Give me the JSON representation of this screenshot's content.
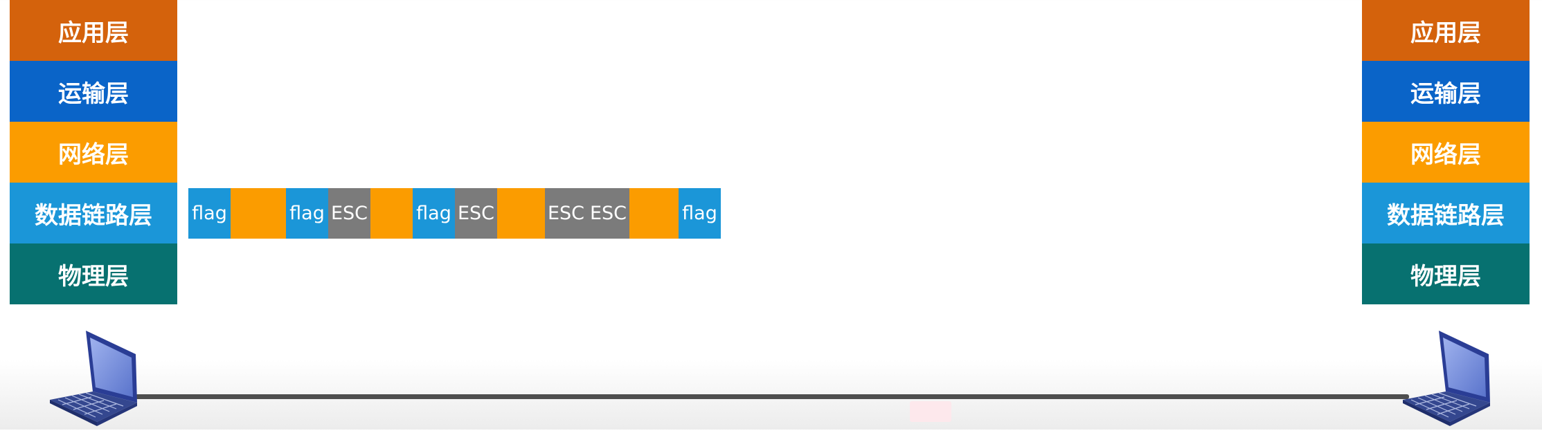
{
  "left_stack": {
    "layers": [
      "应用层",
      "运输层",
      "网络层",
      "数据链路层",
      "物理层"
    ]
  },
  "right_stack": {
    "layers": [
      "应用层",
      "运输层",
      "网络层",
      "数据链路层",
      "物理层"
    ]
  },
  "frame": {
    "segments": [
      {
        "type": "flag",
        "label": "flag"
      },
      {
        "type": "data",
        "label": ""
      },
      {
        "type": "flag",
        "label": "flag"
      },
      {
        "type": "esc",
        "label": "ESC"
      },
      {
        "type": "data",
        "label": ""
      },
      {
        "type": "flag",
        "label": "flag"
      },
      {
        "type": "esc",
        "label": "ESC"
      },
      {
        "type": "data",
        "label": ""
      },
      {
        "type": "esc",
        "label": "ESC"
      },
      {
        "type": "esc",
        "label": "ESC"
      },
      {
        "type": "data",
        "label": ""
      },
      {
        "type": "flag",
        "label": "flag"
      }
    ]
  },
  "colors": {
    "application": "#d4620c",
    "transport": "#0a64c8",
    "network": "#fb9c00",
    "data_link": "#1b96d8",
    "physical": "#077170",
    "esc": "#7b7b7b",
    "data": "#fb9c00"
  },
  "icons": {
    "left_host": "laptop-icon",
    "right_host": "laptop-icon"
  }
}
